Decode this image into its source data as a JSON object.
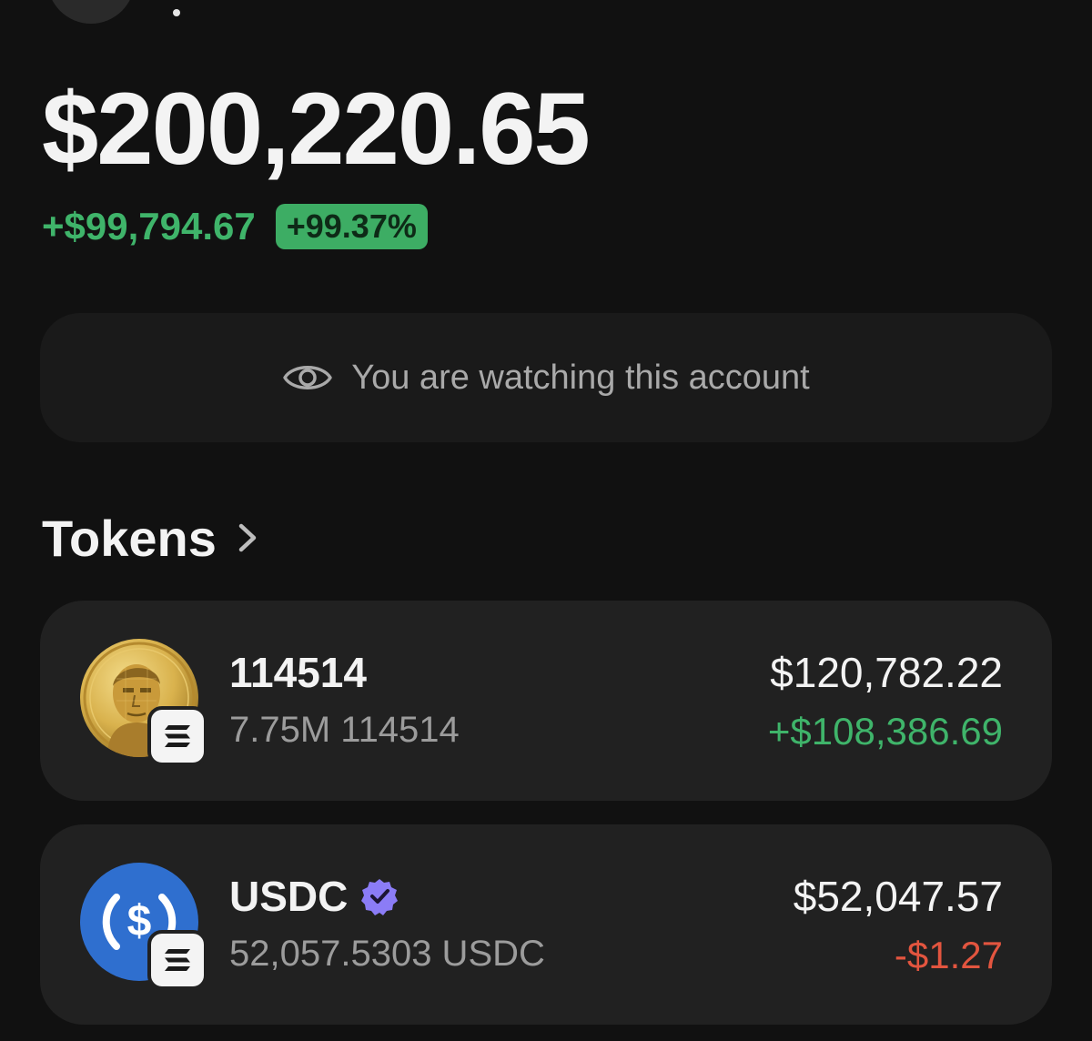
{
  "portfolio": {
    "balance": "$200,220.65",
    "change_amount": "+$99,794.67",
    "change_percent": "+99.37%"
  },
  "watch_banner": {
    "icon": "eye-icon",
    "text": "You are watching this account"
  },
  "tokens_section": {
    "title": "Tokens",
    "icon": "chevron-right-icon"
  },
  "tokens": [
    {
      "name": "114514",
      "quantity": "7.75M 114514",
      "value": "$120,782.22",
      "change": "+$108,386.69",
      "change_direction": "up",
      "logo": "gold-coin-portrait-logo",
      "chain_badge": "solana-badge-icon"
    },
    {
      "name": "USDC",
      "verified": true,
      "verified_icon": "verified-badge-icon",
      "quantity": "52,057.5303 USDC",
      "value": "$52,047.57",
      "change": "-$1.27",
      "change_direction": "down",
      "logo": "usdc-logo",
      "chain_badge": "solana-badge-icon"
    }
  ],
  "colors": {
    "background": "#111111",
    "card": "#212121",
    "positive": "#3fb46a",
    "negative": "#e3553f",
    "verified": "#8b7cf6",
    "usdc_blue": "#2f6fcf"
  }
}
